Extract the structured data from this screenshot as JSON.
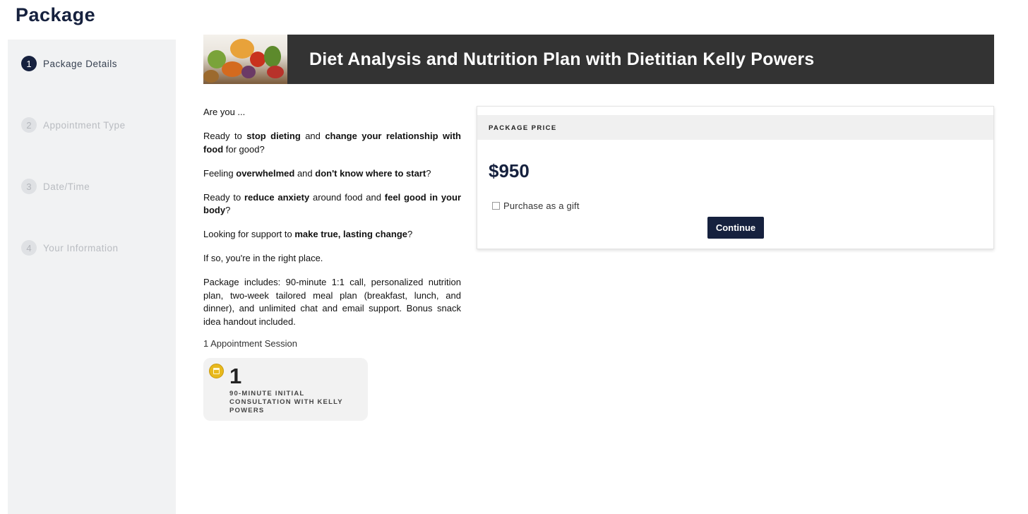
{
  "page": {
    "title": "Package"
  },
  "steps": [
    {
      "number": "1",
      "label": "Package Details",
      "active": true
    },
    {
      "number": "2",
      "label": "Appointment Type",
      "active": false
    },
    {
      "number": "3",
      "label": "Date/Time",
      "active": false
    },
    {
      "number": "4",
      "label": "Your Information",
      "active": false
    }
  ],
  "banner": {
    "title": "Diet Analysis and Nutrition Plan with Dietitian Kelly Powers"
  },
  "description": {
    "p1": "Are you ...",
    "p2": {
      "a": "Ready to ",
      "b": "stop dieting",
      "c": " and ",
      "d": "change your relationship with food",
      "e": " for good?"
    },
    "p3": {
      "a": "Feeling ",
      "b": "overwhelmed",
      "c": " and ",
      "d": "don't know where to start",
      "e": "?"
    },
    "p4": {
      "a": "Ready to ",
      "b": "reduce anxiety",
      "c": " around food and ",
      "d": "feel good in your body",
      "e": "?"
    },
    "p5": {
      "a": "Looking for support to ",
      "b": "make true, lasting change",
      "c": "?"
    },
    "p6": "If so, you're in the right place.",
    "p7": "Package includes: 90-minute 1:1 call, personalized nutrition plan, two-week tailored meal plan (breakfast, lunch, and dinner), and unlimited chat and email support. Bonus snack idea handout included."
  },
  "sessions": {
    "summary": "1 Appointment Session",
    "card": {
      "quantity": "1",
      "name": "90-MINUTE INITIAL CONSULTATION WITH KELLY POWERS",
      "icon": "calendar-icon"
    }
  },
  "price_card": {
    "header": "PACKAGE PRICE",
    "amount": "$950",
    "gift_label": "Purchase as a gift",
    "gift_checked": false,
    "continue_label": "Continue"
  },
  "colors": {
    "primary": "#16213e",
    "banner_bg": "#333333",
    "sidebar_bg": "#f1f2f3",
    "icon_gold": "#e8b91c"
  }
}
